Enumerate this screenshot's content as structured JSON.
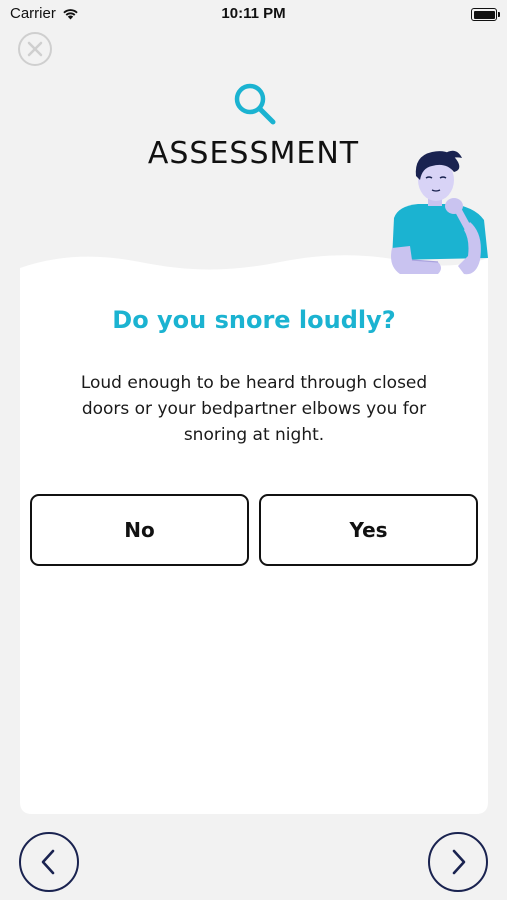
{
  "status_bar": {
    "carrier": "Carrier",
    "time": "10:11 PM"
  },
  "header": {
    "title": "ASSESSMENT",
    "icon": "search-icon"
  },
  "question": {
    "title": "Do you snore loudly?",
    "description": "Loud enough to be heard through closed doors or your bedpartner elbows you for snoring at night."
  },
  "answers": {
    "no_label": "No",
    "yes_label": "Yes"
  },
  "navigation": {
    "prev_icon": "chevron-left-icon",
    "next_icon": "chevron-right-icon",
    "close_icon": "close-icon"
  },
  "colors": {
    "accent": "#1bb3d1",
    "navy": "#1a2350",
    "background": "#f2f2f2"
  }
}
